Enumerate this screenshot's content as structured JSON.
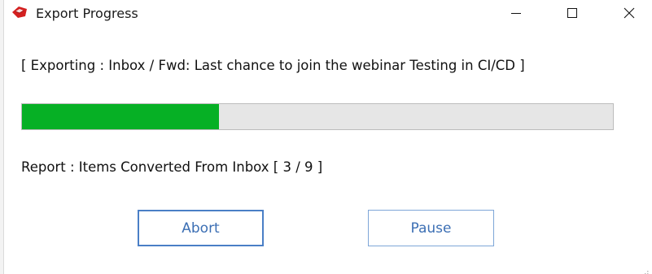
{
  "window": {
    "title": "Export Progress",
    "app_icon": "red-envelope-icon",
    "controls": [
      "minimize-icon",
      "maximize-icon",
      "close-icon"
    ]
  },
  "status": {
    "exporting_text": "[ Exporting : Inbox / Fwd: Last chance to join the webinar Testing in CI/CD ]"
  },
  "progress": {
    "fraction": 0.333,
    "fill_color": "#06b025",
    "track_color": "#e6e6e6"
  },
  "report": {
    "text": "Report :  Items Converted From Inbox [ 3 / 9 ]"
  },
  "buttons": {
    "abort_label": "Abort",
    "pause_label": "Pause"
  },
  "colors": {
    "accent": "#4a7fc6",
    "button_text": "#3c6fb4"
  }
}
